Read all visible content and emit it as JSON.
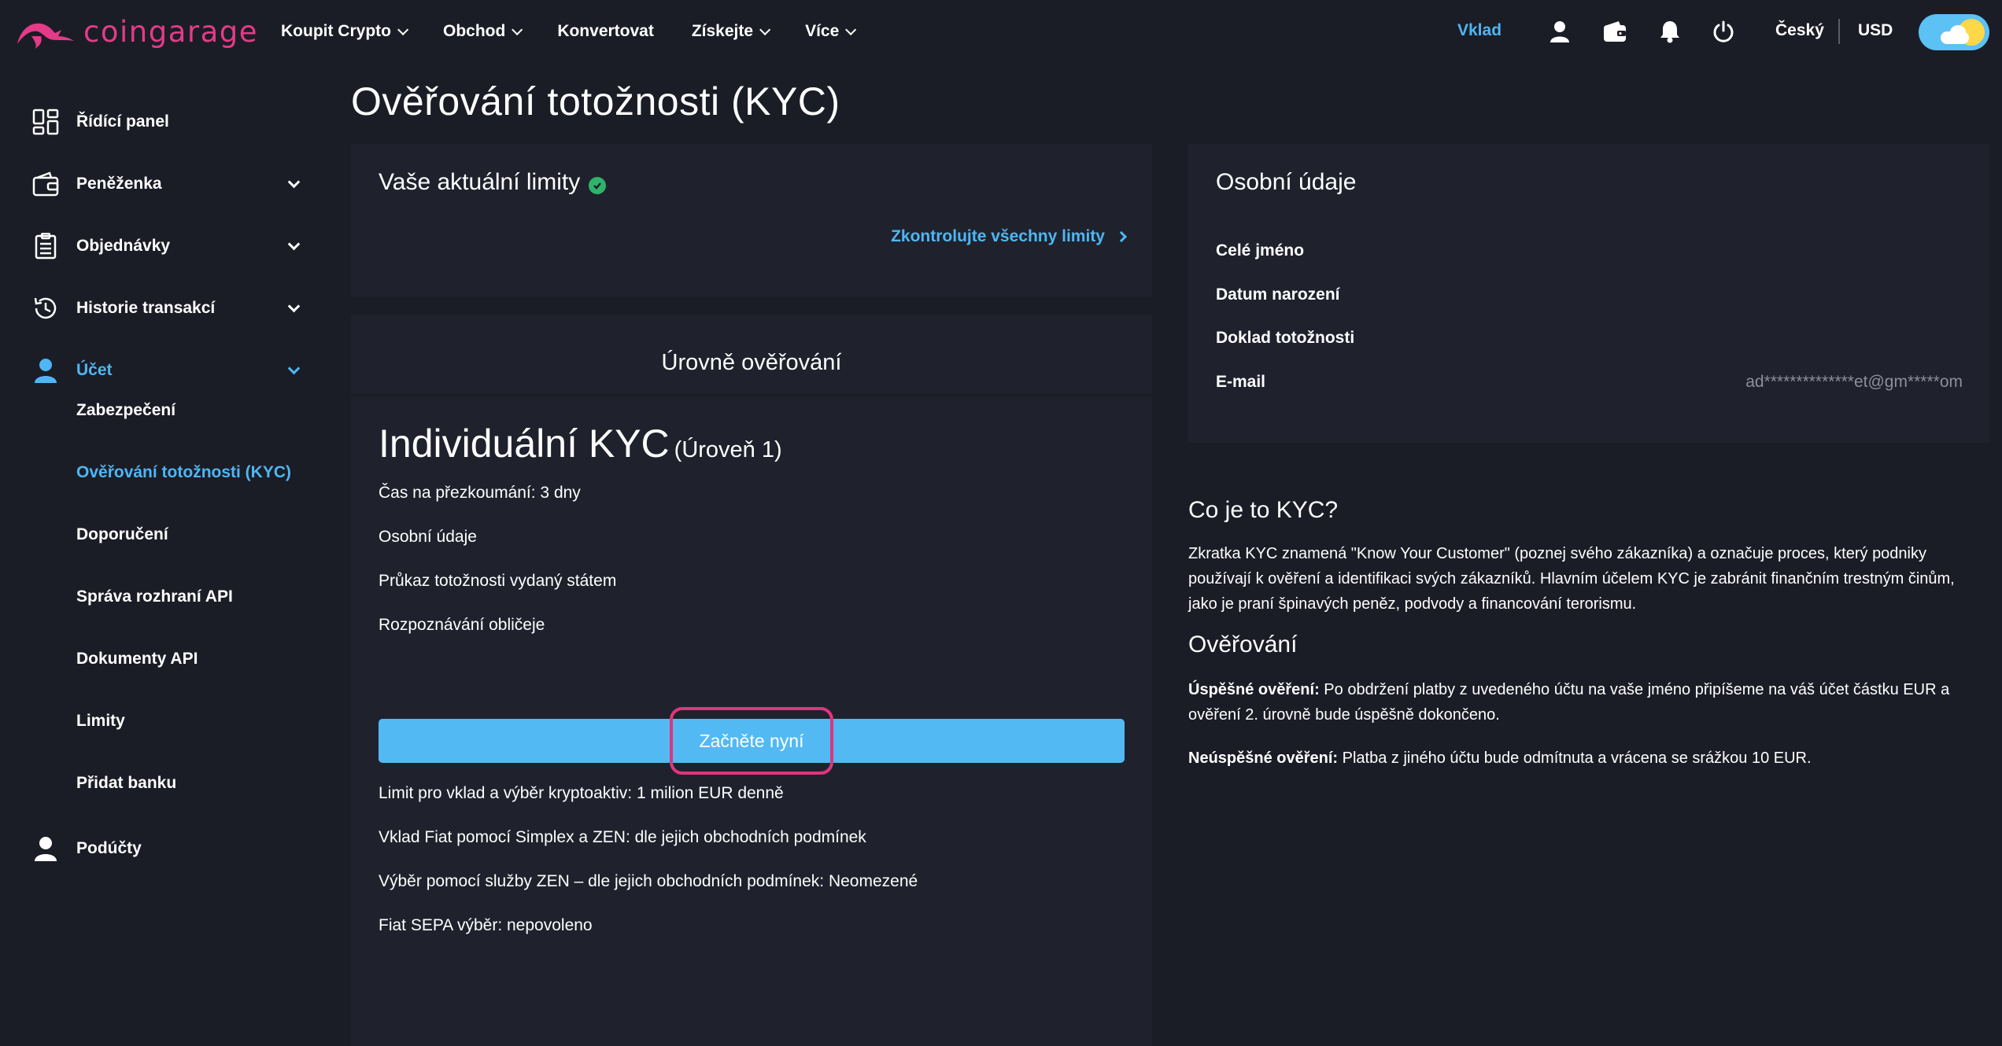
{
  "brand": {
    "name": "coingarage",
    "color": "#e33b87"
  },
  "accent_color": "#4fb6f3",
  "nav": {
    "items": [
      {
        "label": "Koupit Crypto",
        "has_dropdown": true
      },
      {
        "label": "Obchod",
        "has_dropdown": true
      },
      {
        "label": "Konvertovat",
        "has_dropdown": false
      },
      {
        "label": "Získejte",
        "has_dropdown": true
      },
      {
        "label": "Více",
        "has_dropdown": true
      }
    ],
    "deposit": "Vklad",
    "icons": [
      "user-icon",
      "wallet-icon",
      "bell-icon",
      "power-icon"
    ],
    "language": "Český",
    "currency": "USD"
  },
  "sidebar": {
    "items": [
      {
        "label": "Řídící panel",
        "icon": "dashboard-icon"
      },
      {
        "label": "Peněženka",
        "icon": "wallet-icon"
      },
      {
        "label": "Objednávky",
        "icon": "clipboard-icon"
      },
      {
        "label": "Historie transakcí",
        "icon": "history-icon"
      },
      {
        "label": "Účet",
        "icon": "user-icon"
      },
      {
        "label": "Podúčty",
        "icon": "user-icon"
      }
    ],
    "sub_items": [
      "Zabezpečení",
      "Ověřování totožnosti (KYC)",
      "Doporučení",
      "Správa rozhraní API",
      "Dokumenty API",
      "Limity",
      "Přidat banku"
    ]
  },
  "page": {
    "title": "Ověřování totožnosti (KYC)"
  },
  "limits": {
    "title": "Vaše aktuální limity",
    "check_link": "Zkontrolujte všechny limity"
  },
  "levels": {
    "title": "Úrovně ověřování"
  },
  "kyc_card": {
    "title": "Individuální KYC",
    "level": "(Úroveň 1)",
    "requirements": [
      "Čas na přezkoumání: 3 dny",
      "Osobní údaje",
      "Průkaz totožnosti vydaný státem",
      "Rozpoznávání obličeje"
    ],
    "start_button": "Začněte nyní",
    "benefits": [
      "Limit pro vklad a výběr kryptoaktiv: 1 milion EUR denně",
      "Vklad Fiat pomocí Simplex a ZEN: dle jejich obchodních podmínek",
      "Výběr pomocí služby ZEN – dle jejich obchodních podmínek: Neomezené",
      "Fiat SEPA výběr: nepovoleno"
    ]
  },
  "personal": {
    "title": "Osobní údaje",
    "fields": [
      {
        "label": "Celé jméno",
        "value": ""
      },
      {
        "label": "Datum narození",
        "value": ""
      },
      {
        "label": "Doklad totožnosti",
        "value": ""
      },
      {
        "label": "E-mail",
        "value": "ad**************et@gm*****om"
      }
    ]
  },
  "info": {
    "what_title": "Co je to KYC?",
    "what_text": "Zkratka KYC znamená \"Know Your Customer\" (poznej svého zákazníka) a označuje proces, který podniky používají k ověření a identifikaci svých zákazníků. Hlavním účelem KYC je zabránit finančním trestným činům, jako je praní špinavých peněz, podvody a financování terorismu.",
    "verify_title": "Ověřování",
    "success_label": "Úspěšné ověření:",
    "success_text": "Po obdržení platby z uvedeného účtu na vaše jméno připíšeme na váš účet částku EUR a ověření 2. úrovně bude úspěšně dokončeno.",
    "fail_label": "Neúspěšné ověření:",
    "fail_text": "Platba z jiného účtu bude odmítnuta a vrácena se srážkou 10 EUR."
  }
}
